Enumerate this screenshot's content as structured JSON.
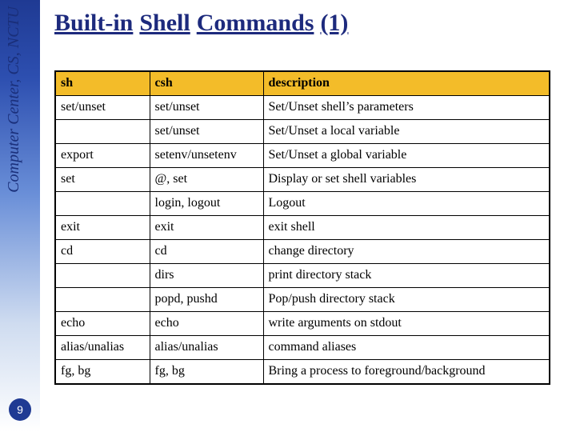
{
  "sidebar_text": "Computer Center, CS, NCTU",
  "page_number": "9",
  "title": "Built-in Shell Commands (1)",
  "headers": [
    "sh",
    "csh",
    "description"
  ],
  "rows": [
    {
      "sh": "set/unset",
      "csh": "set/unset",
      "desc": "Set/Unset shell’s parameters"
    },
    {
      "sh": "",
      "csh": "set/unset",
      "desc": "Set/Unset a local variable"
    },
    {
      "sh": "export",
      "csh": "setenv/unsetenv",
      "desc": "Set/Unset a global variable"
    },
    {
      "sh": "set",
      "csh": "@, set",
      "desc": "Display or set shell variables"
    },
    {
      "sh": "",
      "csh": "login, logout",
      "desc": "Logout"
    },
    {
      "sh": "exit",
      "csh": "exit",
      "desc": "exit shell"
    },
    {
      "sh": "cd",
      "csh": "cd",
      "desc": "change directory"
    },
    {
      "sh": "",
      "csh": "dirs",
      "desc": "print directory stack"
    },
    {
      "sh": "",
      "csh": "popd, pushd",
      "desc": "Pop/push directory stack"
    },
    {
      "sh": "echo",
      "csh": "echo",
      "desc": "write arguments on stdout"
    },
    {
      "sh": "alias/unalias",
      "csh": "alias/unalias",
      "desc": "command aliases"
    },
    {
      "sh": "fg, bg",
      "csh": "fg, bg",
      "desc": "Bring a process to foreground/background"
    }
  ]
}
